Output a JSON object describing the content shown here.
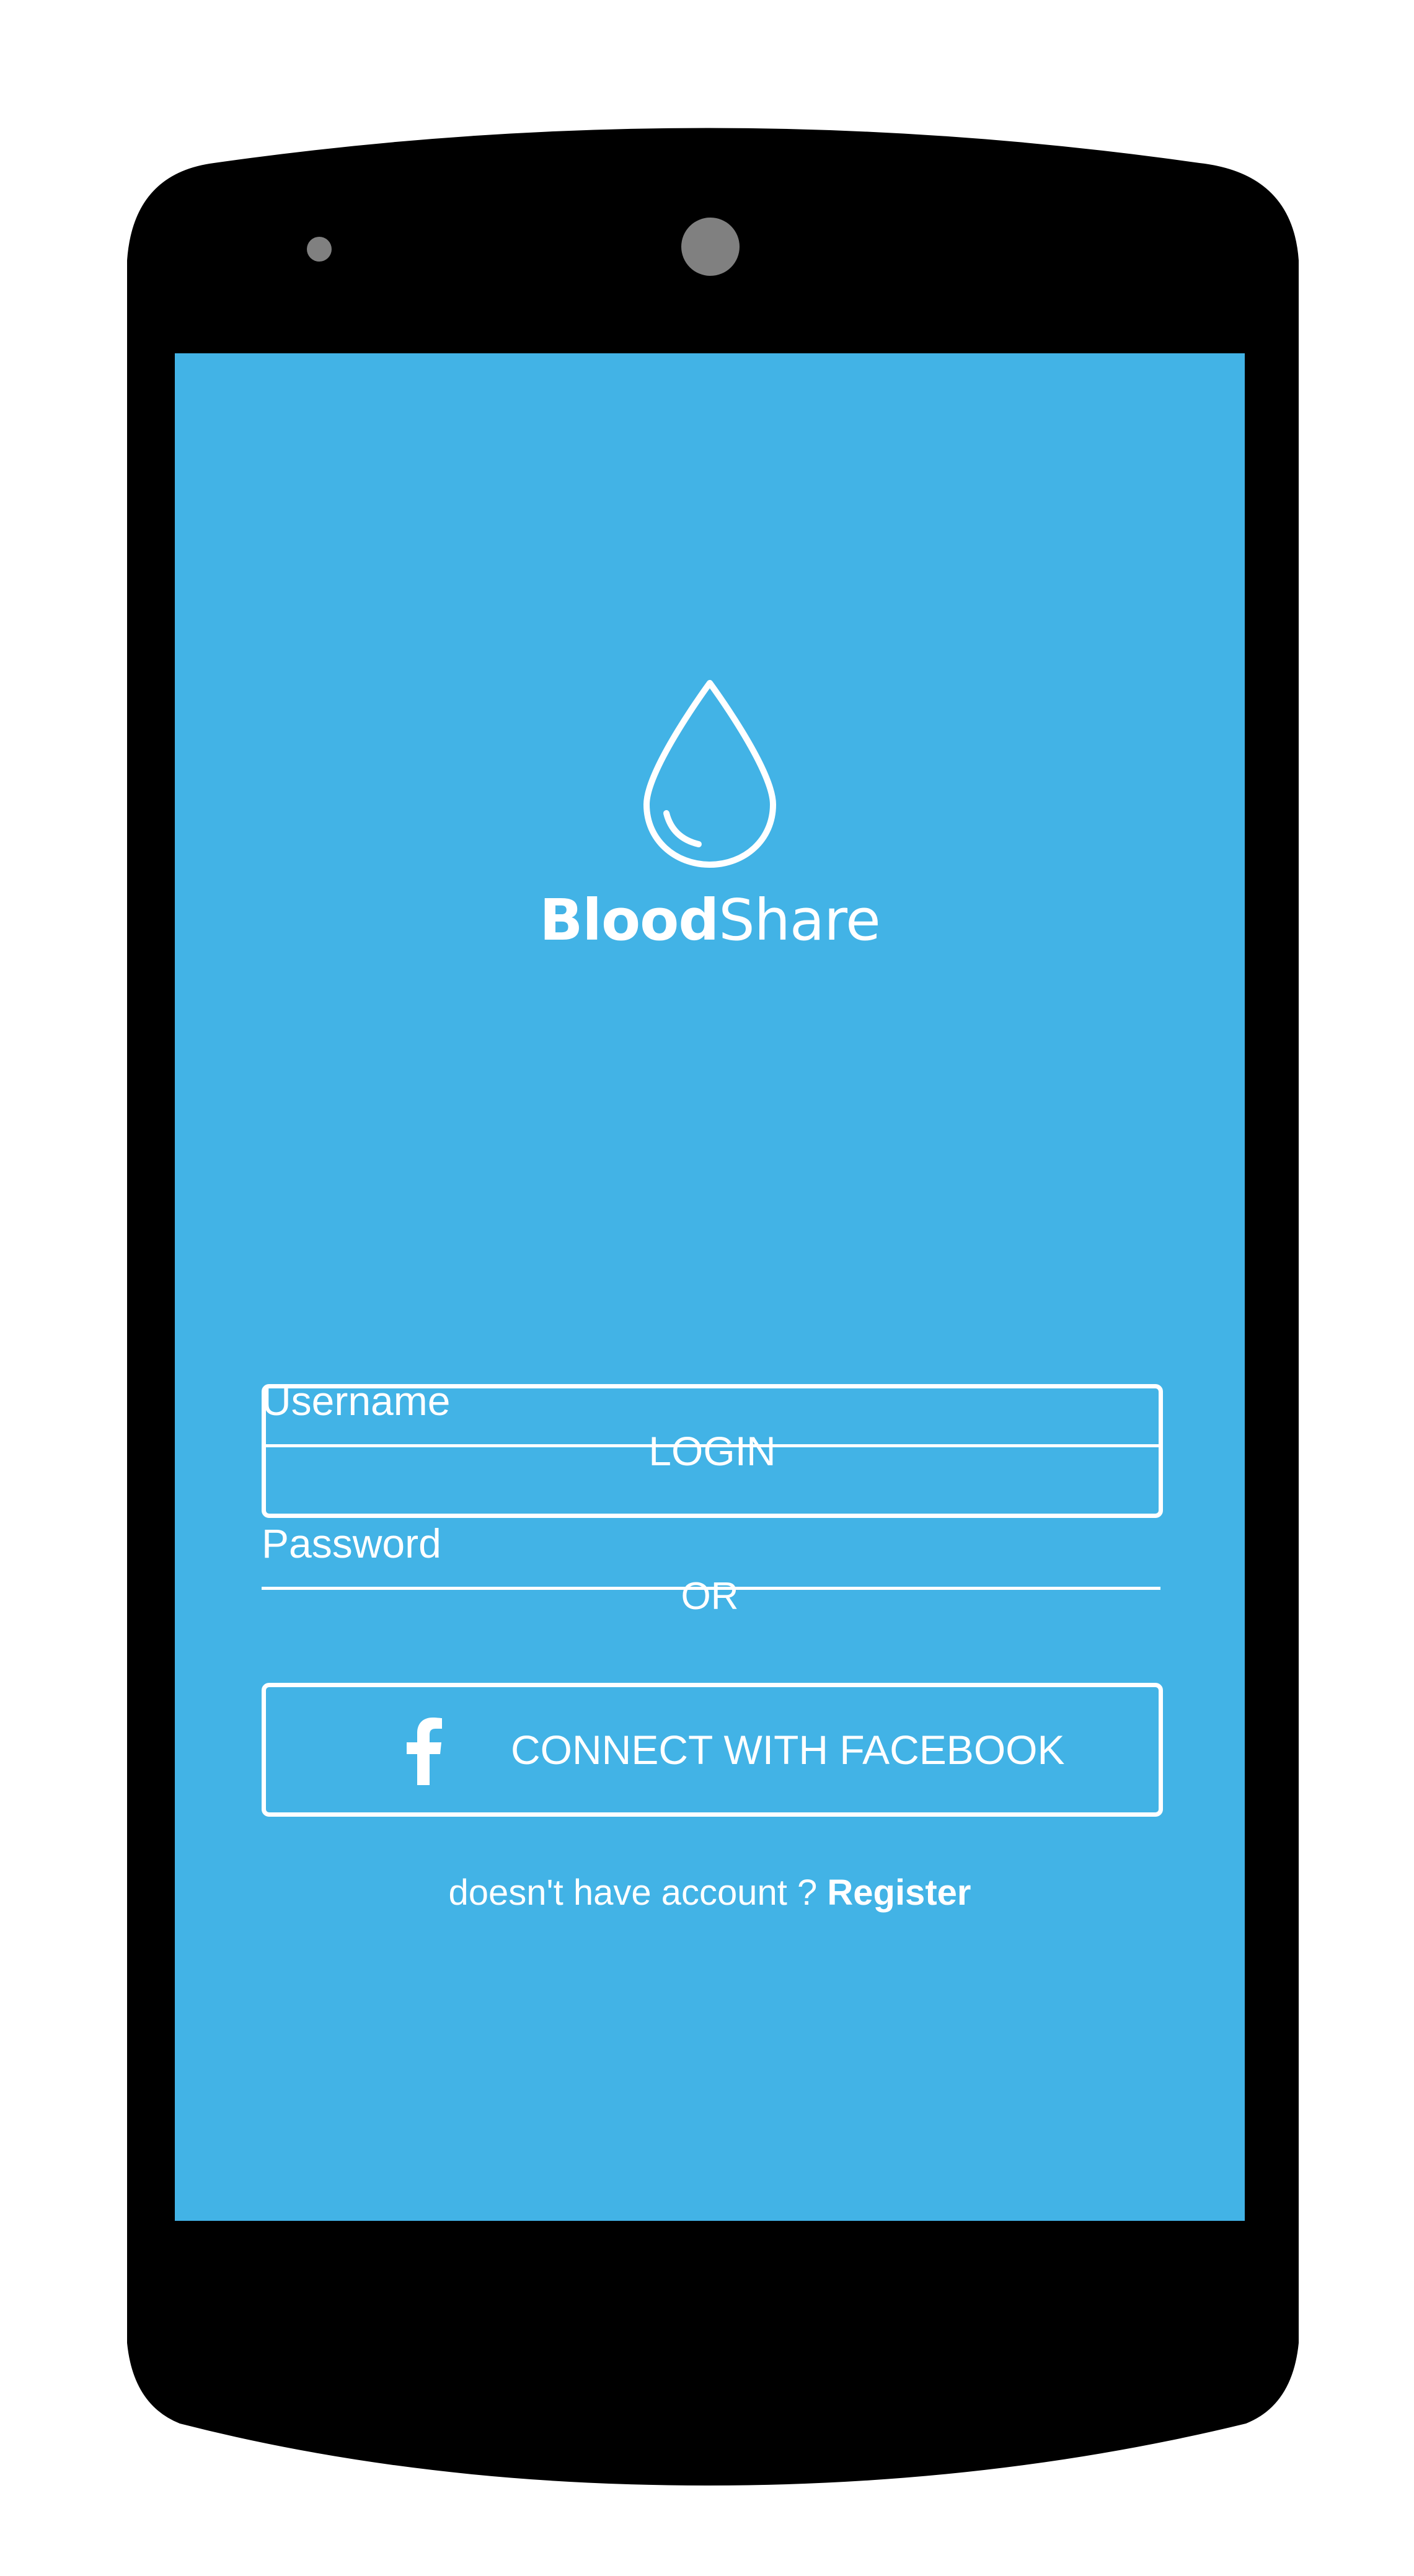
{
  "app": {
    "brand_bold": "Blood",
    "brand_light": "Share"
  },
  "form": {
    "username_placeholder": "Username",
    "password_placeholder": "Password",
    "login_label": "LOGIN",
    "or_label": "OR",
    "facebook_label": "CONNECT WITH FACEBOOK"
  },
  "footer": {
    "prompt": "doesn't have account ? ",
    "register_label": "Register"
  },
  "icons": {
    "logo": "blood-drop-icon",
    "facebook": "facebook-icon"
  },
  "colors": {
    "screen_background": "#42b3e6",
    "phone_body": "#000000",
    "text": "#ffffff"
  }
}
